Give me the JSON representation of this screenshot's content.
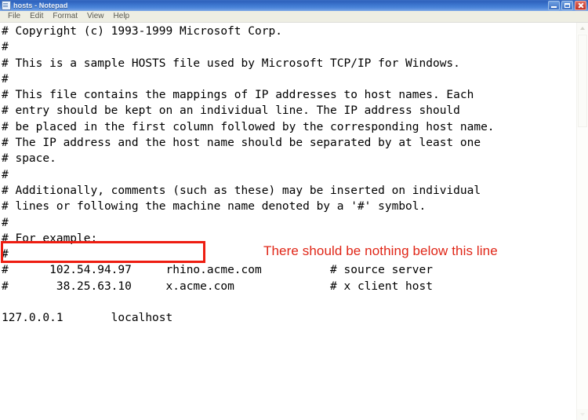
{
  "window": {
    "title": "hosts - Notepad",
    "icon": "notepad-document-icon",
    "controls": {
      "minimize": "Minimize",
      "maximize": "Restore",
      "close": "Close"
    }
  },
  "menubar": {
    "items": [
      {
        "label": "File"
      },
      {
        "label": "Edit"
      },
      {
        "label": "Format"
      },
      {
        "label": "View"
      },
      {
        "label": "Help"
      }
    ]
  },
  "document": {
    "lines": [
      "# Copyright (c) 1993-1999 Microsoft Corp.",
      "#",
      "# This is a sample HOSTS file used by Microsoft TCP/IP for Windows.",
      "#",
      "# This file contains the mappings of IP addresses to host names. Each",
      "# entry should be kept on an individual line. The IP address should",
      "# be placed in the first column followed by the corresponding host name.",
      "# The IP address and the host name should be separated by at least one",
      "# space.",
      "#",
      "# Additionally, comments (such as these) may be inserted on individual",
      "# lines or following the machine name denoted by a '#' symbol.",
      "#",
      "# For example:",
      "#",
      "#      102.54.94.97     rhino.acme.com          # source server",
      "#       38.25.63.10     x.acme.com              # x client host",
      "",
      "127.0.0.1       localhost"
    ]
  },
  "annotations": {
    "note_text": "There should be nothing below this line",
    "note_color": "#e02617",
    "box_color": "#ee1d11",
    "boxed_line": "127.0.0.1       localhost"
  },
  "scrollbar": {
    "up_arrow": "scroll-up-arrow-icon",
    "down_arrow": "scroll-down-arrow-icon"
  }
}
